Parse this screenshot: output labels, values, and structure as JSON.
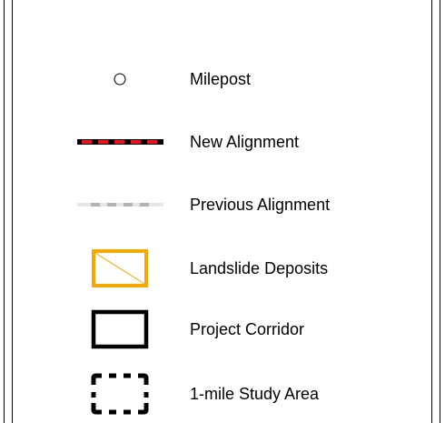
{
  "legend": {
    "items": [
      {
        "label": "Milepost",
        "icon": "milepost-circle-icon"
      },
      {
        "label": "New Alignment",
        "icon": "new-alignment-line-icon",
        "colors": [
          "#e8141d",
          "#000000"
        ]
      },
      {
        "label": "Previous Alignment",
        "icon": "previous-alignment-line-icon",
        "colors": [
          "#b3b3b3",
          "#e6e6e6"
        ]
      },
      {
        "label": "Landslide Deposits",
        "icon": "landslide-deposits-box-icon",
        "colors": [
          "#f5a800"
        ]
      },
      {
        "label": "Project Corridor",
        "icon": "project-corridor-box-icon",
        "colors": [
          "#000000"
        ]
      },
      {
        "label": "1-mile Study Area",
        "icon": "study-area-checkered-box-icon",
        "colors": [
          "#000000",
          "#ffffff"
        ]
      }
    ]
  }
}
